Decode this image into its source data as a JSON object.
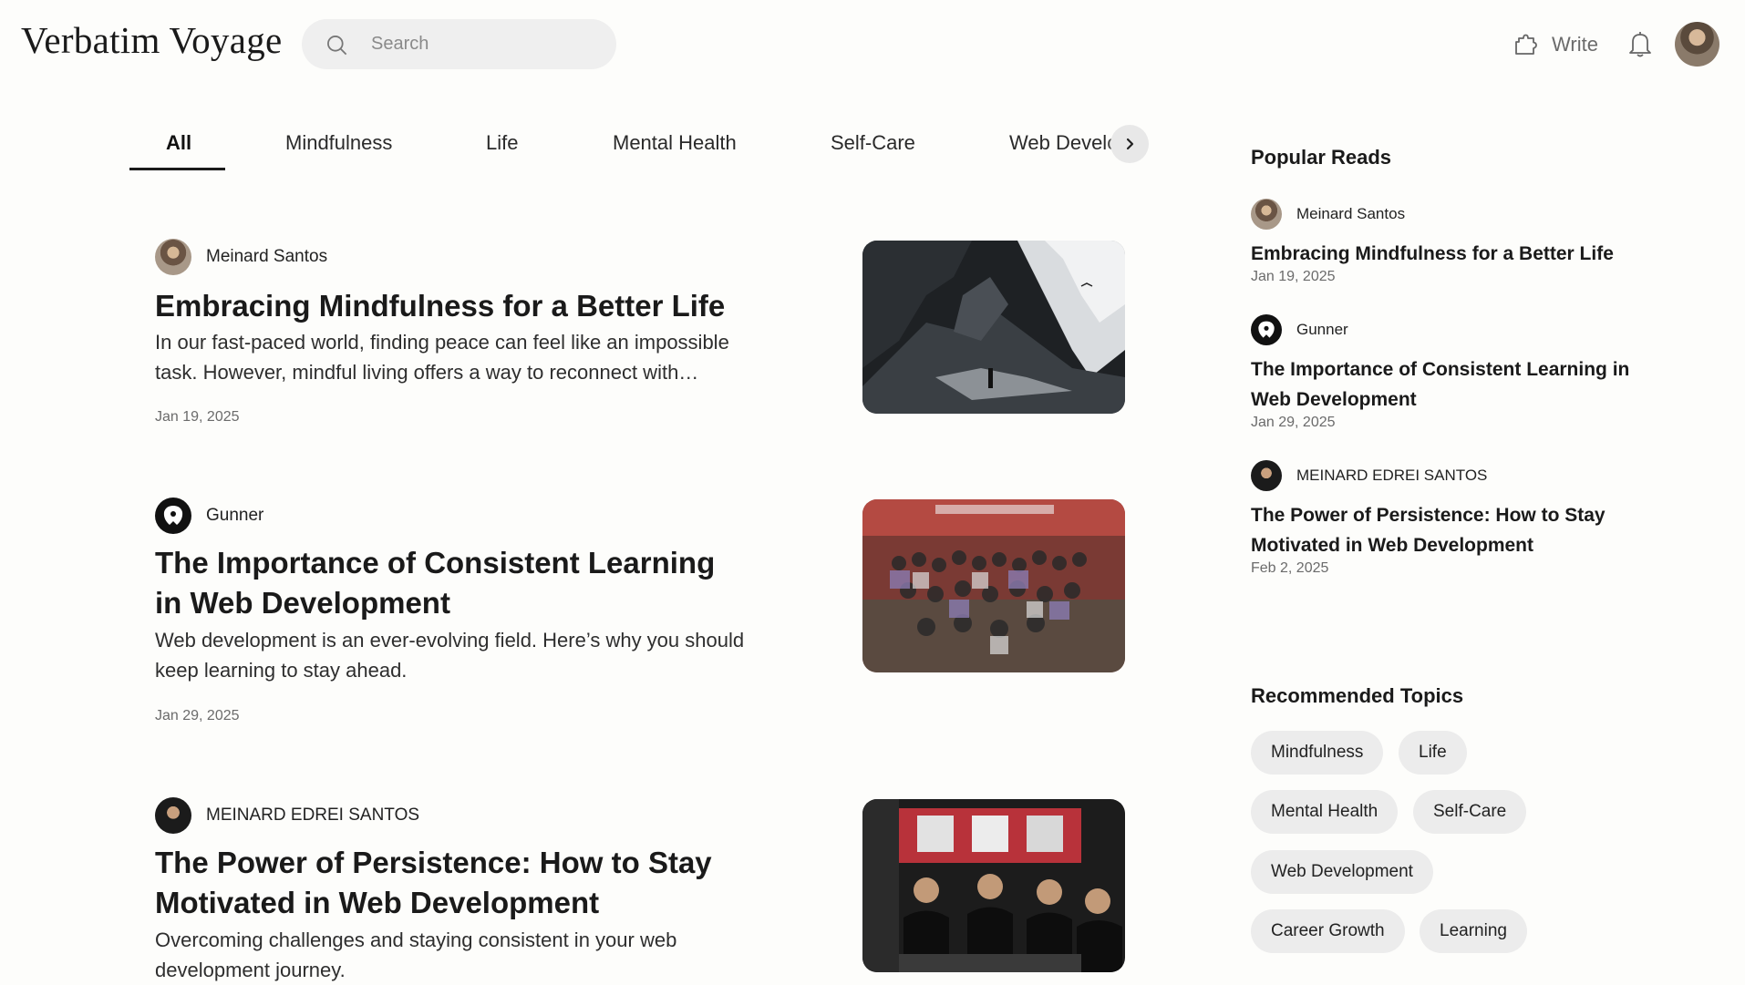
{
  "header": {
    "logo": "Verbatim Voyage",
    "search_placeholder": "Search",
    "write_label": "Write"
  },
  "tabs": [
    "All",
    "Mindfulness",
    "Life",
    "Mental Health",
    "Self-Care",
    "Web Development"
  ],
  "active_tab": "All",
  "articles": [
    {
      "author": "Meinard Santos",
      "title": "Embracing Mindfulness for a Better Life",
      "excerpt": "In our fast-paced world, finding peace can feel like an impossible task. However, mindful living offers a way to reconnect with…",
      "date": "Jan 19, 2025"
    },
    {
      "author": "Gunner",
      "title": "The Importance of Consistent Learning in Web Development",
      "excerpt": "Web development is an ever-evolving field. Here’s why you should keep learning to stay ahead.",
      "date": "Jan 29, 2025"
    },
    {
      "author": "MEINARD EDREI SANTOS",
      "title": "The Power of Persistence: How to Stay Motivated in Web Development",
      "excerpt": "Overcoming challenges and staying consistent in your web development journey.",
      "date": ""
    }
  ],
  "sidebar": {
    "popular_heading": "Popular Reads",
    "popular": [
      {
        "author": "Meinard Santos",
        "title": "Embracing Mindfulness for a Better Life",
        "date": "Jan 19, 2025"
      },
      {
        "author": "Gunner",
        "title": "The Importance of Consistent Learning in Web Development",
        "date": "Jan 29, 2025"
      },
      {
        "author": "MEINARD EDREI SANTOS",
        "title": "The Power of Persistence: How to Stay Motivated in Web Development",
        "date": "Feb 2, 2025"
      }
    ],
    "topics_heading": "Recommended Topics",
    "topics": [
      "Mindfulness",
      "Life",
      "Mental Health",
      "Self-Care",
      "Web Development",
      "Career Growth",
      "Learning"
    ]
  }
}
